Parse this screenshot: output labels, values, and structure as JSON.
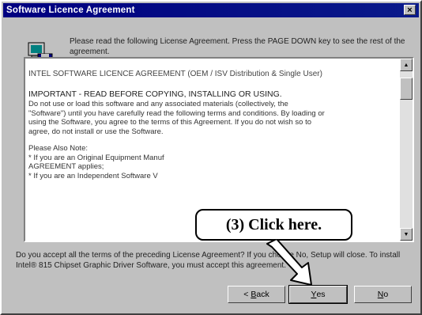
{
  "window": {
    "title": "Software Licence Agreement",
    "close_glyph": "×"
  },
  "intro": {
    "text": "Please read the following License Agreement. Press the PAGE DOWN key to see the rest of the agreement."
  },
  "license": {
    "heading": "INTEL SOFTWARE LICENCE AGREEMENT (OEM / ISV Distribution & Single User)",
    "important": "IMPORTANT - READ BEFORE COPYING, INSTALLING OR USING.",
    "body_lines": [
      "Do not use or load this software and any associated materials (collectively, the",
      "\"Software\") until you have carefully read the following terms and conditions. By loading or",
      "using the Software, you agree to the terms of this Agreement. If you do not wish so to",
      "agree, do not install or use the Software."
    ],
    "note_lines": [
      "Please Also Note:",
      "* If you are an Original Equipment Manuf",
      "AGREEMENT applies;",
      "* If you are an Independent Software V"
    ]
  },
  "question": {
    "text": "Do you accept all the terms of the preceding License Agreement? If you choose No, Setup will close. To install Intel® 815 Chipset Graphic Driver Software, you must accept this agreement."
  },
  "buttons": {
    "back_prefix": "< ",
    "back_mnemonic": "B",
    "back_rest": "ack",
    "yes_mnemonic": "Y",
    "yes_rest": "es",
    "no_mnemonic": "N",
    "no_rest": "o"
  },
  "callout": {
    "text": "(3)  Click here."
  },
  "icons": {
    "header": "computer-disk-icon",
    "close": "close-icon",
    "scroll_up": "scroll-up-arrow-icon",
    "scroll_down": "scroll-down-arrow-icon",
    "pointer": "pointer-arrow-icon"
  },
  "colors": {
    "titlebar": "#000080",
    "face": "#c0c0c0"
  }
}
